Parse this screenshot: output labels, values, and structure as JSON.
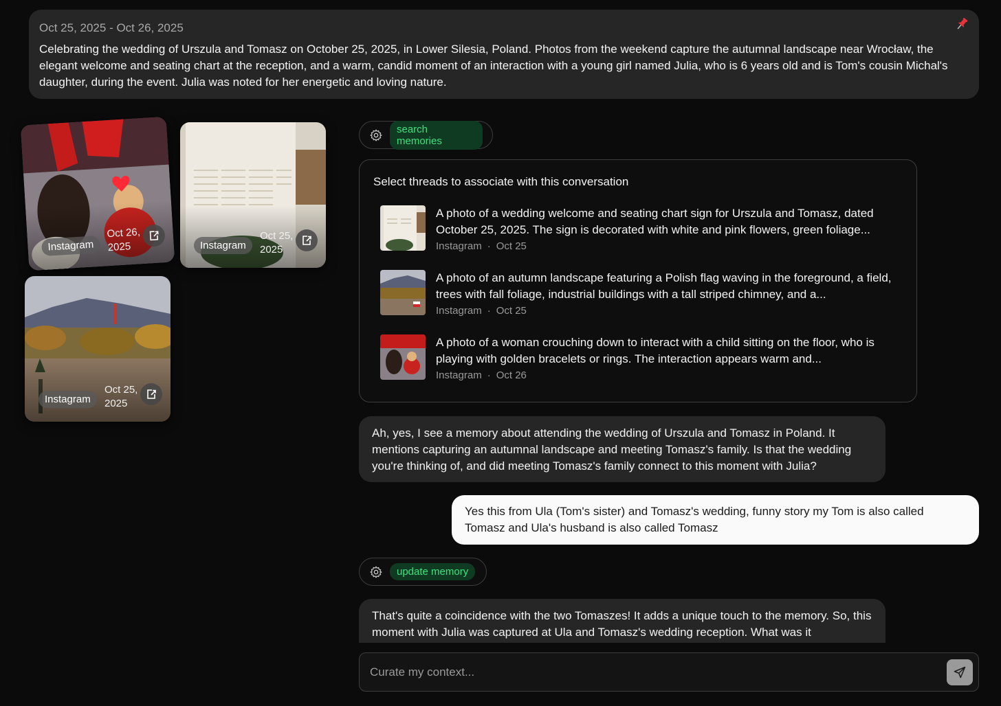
{
  "summary": {
    "date_range": "Oct 25, 2025 - Oct 26, 2025",
    "text": "Celebrating the wedding of Urszula and Tomasz on October 25, 2025, in Lower Silesia, Poland. Photos from the weekend capture the autumnal landscape near Wrocław, the elegant welcome and seating chart at the reception, and a warm, candid moment of an interaction with a young girl named Julia, who is 6 years old and is Tom's cousin Michal's daughter, during the event. Julia was noted for her energetic and loving nature.",
    "pin_icon": "pin-icon",
    "pin_color": "#e8333b"
  },
  "photos": [
    {
      "source": "Instagram",
      "date": "Oct 26, 2025",
      "icon": "share-icon"
    },
    {
      "source": "Instagram",
      "date": "Oct 25, 2025",
      "icon": "share-icon"
    },
    {
      "source": "Instagram",
      "date": "Oct 25, 2025",
      "icon": "share-icon"
    }
  ],
  "tools": {
    "search": {
      "label": "search memories",
      "icon": "gear-icon"
    },
    "update": {
      "label": "update memory",
      "icon": "gear-icon"
    }
  },
  "threads": {
    "title": "Select threads to associate with this conversation",
    "items": [
      {
        "description": "A photo of a wedding welcome and seating chart sign for Urszula and Tomasz, dated October 25, 2025. The sign is decorated with white and pink flowers, green foliage...",
        "source": "Instagram",
        "separator": "·",
        "date": "Oct 25"
      },
      {
        "description": "A photo of an autumn landscape featuring a Polish flag waving in the foreground, a field, trees with fall foliage, industrial buildings with a tall striped chimney, and a...",
        "source": "Instagram",
        "separator": "·",
        "date": "Oct 25"
      },
      {
        "description": "A photo of a woman crouching down to interact with a child sitting on the floor, who is playing with golden bracelets or rings. The interaction appears warm and...",
        "source": "Instagram",
        "separator": "·",
        "date": "Oct 26"
      }
    ]
  },
  "messages": {
    "ai1": "Ah, yes, I see a memory about attending the wedding of Urszula and Tomasz in Poland. It mentions capturing an autumnal landscape and meeting Tomasz's family. Is that the wedding you're thinking of, and did meeting Tomasz's family connect to this moment with Julia?",
    "user1": "Yes this from Ula (Tom's sister) and Tomasz's wedding, funny story my Tom is also called Tomasz and Ula's husband is also called Tomasz",
    "ai2": "That's quite a coincidence with the two Tomaszes! It adds a unique touch to the memory. So, this moment with Julia was captured at Ula and Tomasz's wedding reception. What was it"
  },
  "composer": {
    "placeholder": "Curate my context...",
    "send_icon": "send-icon"
  },
  "colors": {
    "background": "#0b0b0b",
    "card": "#262626",
    "chip_bg": "#0f3b22",
    "chip_text": "#3ee07e"
  }
}
